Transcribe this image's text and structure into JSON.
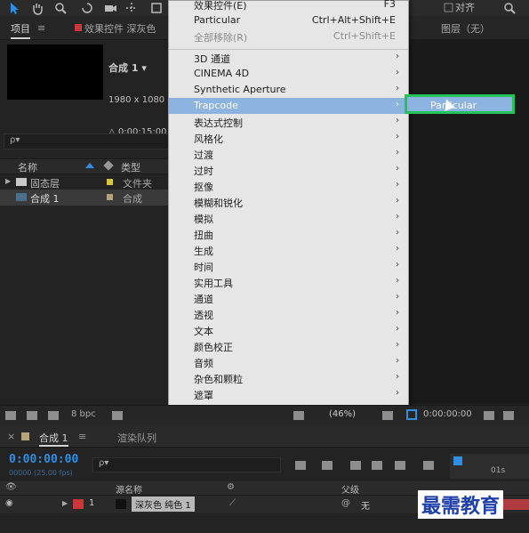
{
  "toolbar": {
    "align_label": "对齐"
  },
  "tabs": {
    "project": "项目",
    "effects": "效果控件 深灰色",
    "layer": "图层（无）"
  },
  "project": {
    "comp_name": "合成 1 ▾",
    "comp_size": "1980 x 1080 (",
    "comp_duration": "△ 0:00:15:00",
    "search_placeholder": "ρ▾",
    "col_name": "名称",
    "col_type": "类型",
    "items": [
      {
        "name": "固态层",
        "type": "文件夹",
        "color": "#d6c73f"
      },
      {
        "name": "合成 1",
        "type": "合成",
        "color": "#b5a37a"
      }
    ],
    "footer_bpc": "8 bpc"
  },
  "menu": {
    "items": [
      {
        "label": "效果控件(E)",
        "shortcut": "F3",
        "submenu": false,
        "disabled": false
      },
      {
        "label": "Particular",
        "shortcut": "Ctrl+Alt+Shift+E",
        "submenu": false,
        "disabled": false
      },
      {
        "label": "全部移除(R)",
        "shortcut": "Ctrl+Shift+E",
        "submenu": false,
        "disabled": true
      },
      {
        "label": "3D 通道",
        "submenu": true
      },
      {
        "label": "CINEMA 4D",
        "submenu": true
      },
      {
        "label": "Synthetic Aperture",
        "submenu": true
      },
      {
        "label": "Trapcode",
        "submenu": true,
        "active": true
      },
      {
        "label": "表达式控制",
        "submenu": true
      },
      {
        "label": "风格化",
        "submenu": true
      },
      {
        "label": "过渡",
        "submenu": true
      },
      {
        "label": "过时",
        "submenu": true
      },
      {
        "label": "抠像",
        "submenu": true
      },
      {
        "label": "模糊和锐化",
        "submenu": true
      },
      {
        "label": "模拟",
        "submenu": true
      },
      {
        "label": "扭曲",
        "submenu": true
      },
      {
        "label": "生成",
        "submenu": true
      },
      {
        "label": "时间",
        "submenu": true
      },
      {
        "label": "实用工具",
        "submenu": true
      },
      {
        "label": "通道",
        "submenu": true
      },
      {
        "label": "透视",
        "submenu": true
      },
      {
        "label": "文本",
        "submenu": true
      },
      {
        "label": "颜色校正",
        "submenu": true
      },
      {
        "label": "音频",
        "submenu": true
      },
      {
        "label": "杂色和颗粒",
        "submenu": true
      },
      {
        "label": "遮罩",
        "submenu": true
      }
    ],
    "submenu_item": "Particular"
  },
  "viewer": {
    "zoom": "(46%)",
    "time": "0:00:00:00"
  },
  "timeline": {
    "tab_comp": "合成 1",
    "tab_render": "渲染队列",
    "timecode": "0:00:00:00",
    "subtime": "00000 (25.00 fps)",
    "search_placeholder": "ρ▾",
    "col_source": "源名称",
    "col_parent": "父级",
    "ruler_mark": "01s",
    "layer": {
      "index": "1",
      "name": "深灰色 纯色 1",
      "parent": "无",
      "color": "#c9373b"
    }
  },
  "watermark": "最需教育"
}
